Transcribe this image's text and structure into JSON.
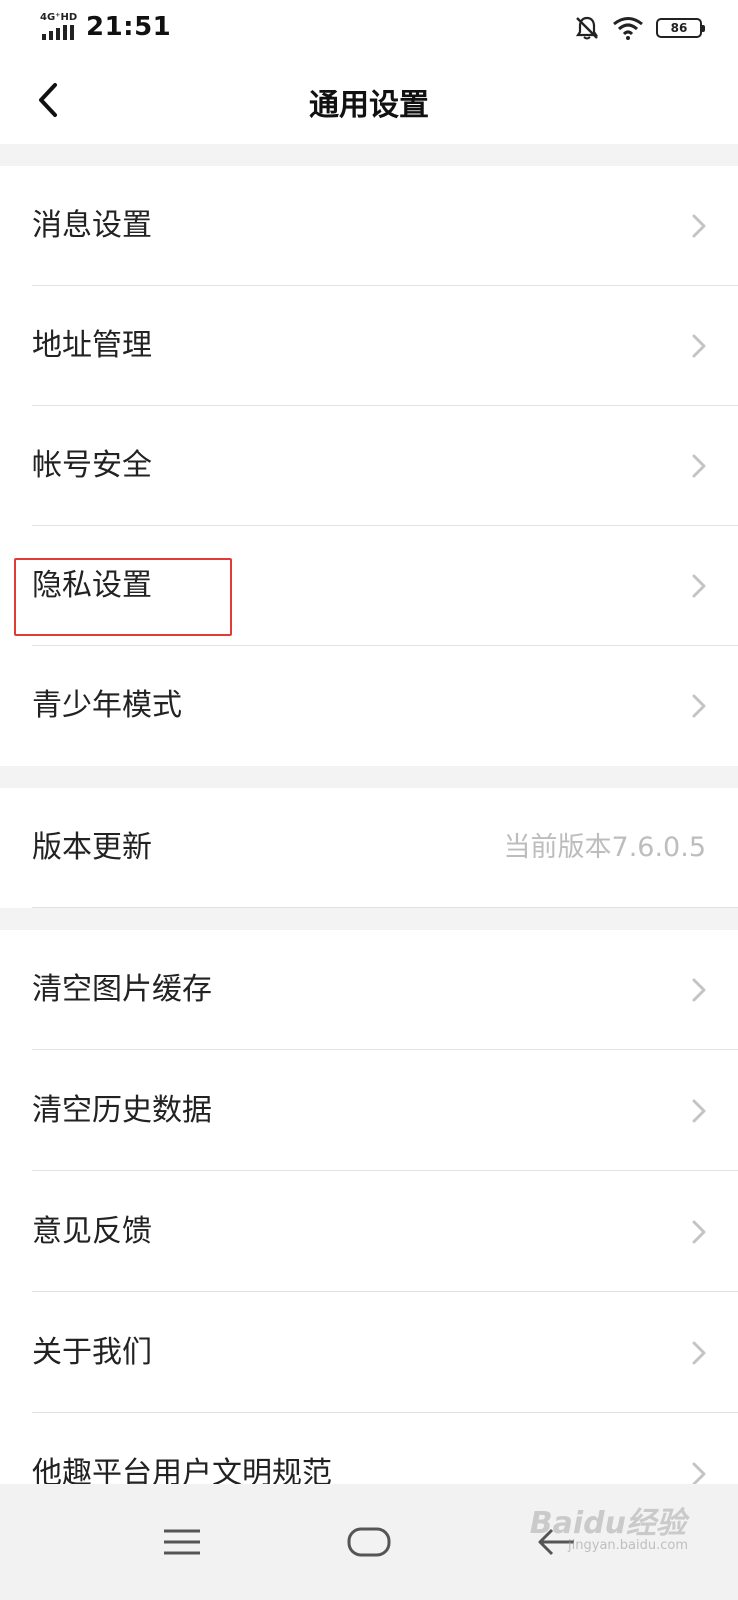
{
  "status_bar": {
    "network": "4G⁺HD",
    "time": "21:51",
    "battery": "86",
    "icons": [
      "signal-icon",
      "mute-bell-icon",
      "wifi-icon",
      "battery-icon"
    ]
  },
  "header": {
    "title": "通用设置",
    "back_icon": "chevron-left-icon"
  },
  "group1": [
    {
      "label": "消息设置"
    },
    {
      "label": "地址管理"
    },
    {
      "label": "帐号安全"
    },
    {
      "label": "隐私设置"
    },
    {
      "label": "青少年模式"
    }
  ],
  "version": {
    "label": "版本更新",
    "value": "当前版本7.6.0.5"
  },
  "group2": [
    {
      "label": "清空图片缓存"
    },
    {
      "label": "清空历史数据"
    },
    {
      "label": "意见反馈"
    },
    {
      "label": "关于我们"
    },
    {
      "label": "他趣平台用户文明规范"
    }
  ],
  "nav": {
    "icons": [
      "menu-icon",
      "home-icon",
      "back-icon"
    ]
  },
  "watermark": {
    "logo": "Baidu经验",
    "url": "jingyan.baidu.com"
  },
  "colors": {
    "highlight": "#e53935",
    "section_gap": "#f3f3f3",
    "divider": "#e2e2e2",
    "secondary_text": "#bdbdbd"
  }
}
